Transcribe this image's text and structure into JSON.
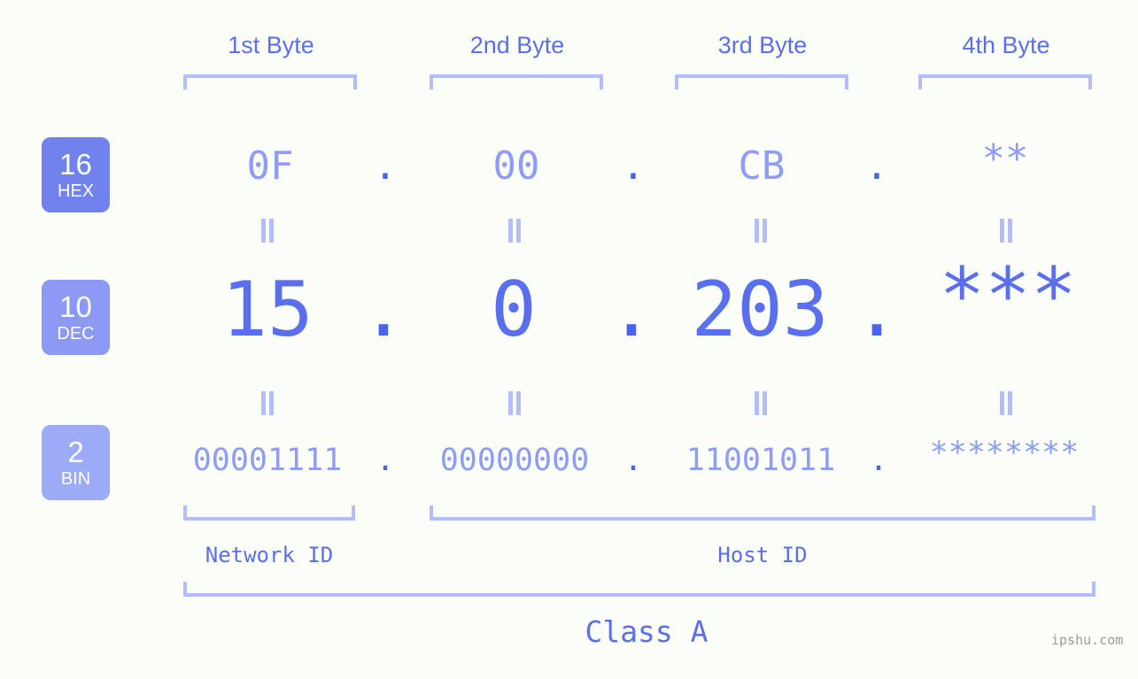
{
  "background_color": "#fbfdf8",
  "accent_color": "#5a6ff0",
  "accent_light_color": "#8e9cf7",
  "bracket_color": "#b3bdfb",
  "byte_headers": [
    {
      "label": "1st Byte"
    },
    {
      "label": "2nd Byte"
    },
    {
      "label": "3rd Byte"
    },
    {
      "label": "4th Byte"
    }
  ],
  "bases": [
    {
      "number": "16",
      "name": "HEX",
      "color": "#7182ef"
    },
    {
      "number": "10",
      "name": "DEC",
      "color": "#8b99f4"
    },
    {
      "number": "2",
      "name": "BIN",
      "color": "#9cabf8"
    }
  ],
  "rows": {
    "hex": {
      "base_number": "16",
      "base_name": "HEX",
      "values": [
        "0F",
        "00",
        "CB",
        "**"
      ],
      "separator": "."
    },
    "dec": {
      "base_number": "10",
      "base_name": "DEC",
      "values": [
        "15",
        "0",
        "203",
        "***"
      ],
      "separator": "."
    },
    "bin": {
      "base_number": "2",
      "base_name": "BIN",
      "values": [
        "00001111",
        "00000000",
        "11001011",
        "********"
      ],
      "separator": "."
    }
  },
  "equals_symbol": "=",
  "sections": [
    {
      "caption": "Network ID"
    },
    {
      "caption": "Host ID"
    }
  ],
  "class_caption": "Class A",
  "watermark": "ipshu.com"
}
